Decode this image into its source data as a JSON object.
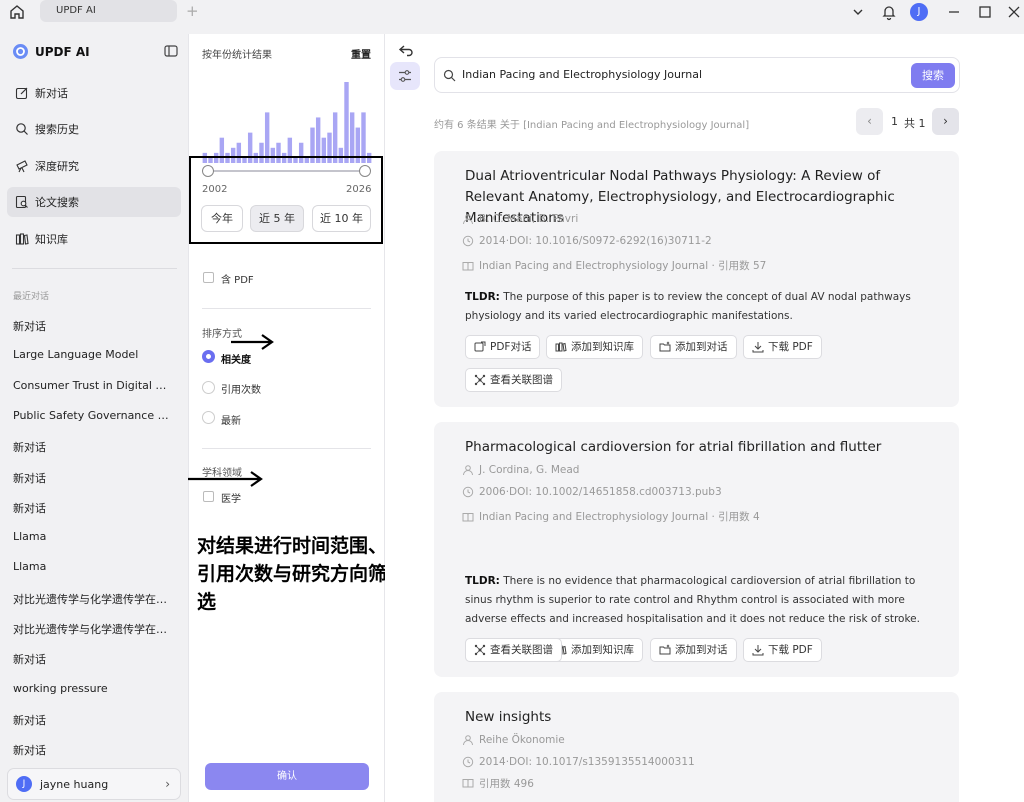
{
  "titlebar": {
    "tab": "UPDF AI"
  },
  "sidebar": {
    "brand": "UPDF AI",
    "nav": [
      {
        "label": "新对话"
      },
      {
        "label": "搜索历史"
      },
      {
        "label": "深度研究"
      },
      {
        "label": "论文搜索"
      },
      {
        "label": "知识库"
      }
    ],
    "recent_label": "最近对话",
    "recent": [
      "新对话",
      "Large Language Model",
      "Consumer Trust in Digital Ma...",
      "Public Safety Governance an...",
      "新对话",
      "新对话",
      "新对话",
      "Llama",
      "Llama",
      "对比光遗传学与化学遗传学在啮...",
      "对比光遗传学与化学遗传学在啮...",
      "新对话",
      "working pressure",
      "新对话",
      "新对话"
    ],
    "user": {
      "initial": "J",
      "name": "jayne huang"
    }
  },
  "filter": {
    "title": "按年份统计结果",
    "reset": "重置",
    "year_start": "2002",
    "year_end": "2026",
    "histogram": [
      2,
      1,
      2,
      5,
      2,
      3,
      4,
      1,
      6,
      2,
      4,
      10,
      3,
      4,
      2,
      5,
      1,
      4,
      1,
      7,
      9,
      5,
      6,
      10,
      3,
      16,
      10,
      7,
      10,
      2
    ],
    "range_buttons": [
      "今年",
      "近 5 年",
      "近 10 年"
    ],
    "pdf_label": "含 PDF",
    "sort_label": "排序方式",
    "sort_options": [
      "相关度",
      "引用次数",
      "最新"
    ],
    "field_label": "学科领域",
    "field_options": [
      "医学"
    ],
    "annotation": "对结果进行时间范围、引用次数与研究方向筛选",
    "confirm": "确认"
  },
  "main": {
    "query": "Indian Pacing and Electrophysiology Journal",
    "search_btn": "搜索",
    "summary": "约有 6 条结果 关于 [Indian Pacing and Electrophysiology Journal]",
    "page_current": "1",
    "page_total": "共 1",
    "actions": [
      "PDF对话",
      "添加到知识库",
      "添加到对话",
      "下载 PDF",
      "查看关联图谱"
    ],
    "papers": [
      {
        "title": "Dual Atrioventricular Nodal Pathways Physiology: A Review of Relevant Anatomy, Electrophysiology, and Electrocardiographic Manifestations",
        "authors": "B. C. Mani, B. Pavri",
        "doi": "2014·DOI: 10.1016/S0972-6292(16)30711-2",
        "journal": "Indian Pacing and Electrophysiology Journal · 引用数 57",
        "tldr_label": "TLDR:",
        "tldr": "The purpose of this paper is to review the concept of dual AV nodal pathways physiology and its varied electrocardiographic manifestations."
      },
      {
        "title": "Pharmacological cardioversion for atrial fibrillation and flutter",
        "authors": "J. Cordina, G. Mead",
        "doi": "2006·DOI: 10.1002/14651858.cd003713.pub3",
        "journal": "Indian Pacing and Electrophysiology Journal · 引用数 4",
        "tldr_label": "TLDR:",
        "tldr": "There is no evidence that pharmacological cardioversion of atrial fibrillation to sinus rhythm is superior to rate control and Rhythm control is associated with more adverse effects and increased hospitalisation and it does not reduce the risk of stroke."
      },
      {
        "title": "New insights",
        "authors": "Reihe Ökonomie",
        "doi": "2014·DOI: 10.1017/s1359135514000311",
        "journal": "引用数 496"
      }
    ]
  }
}
